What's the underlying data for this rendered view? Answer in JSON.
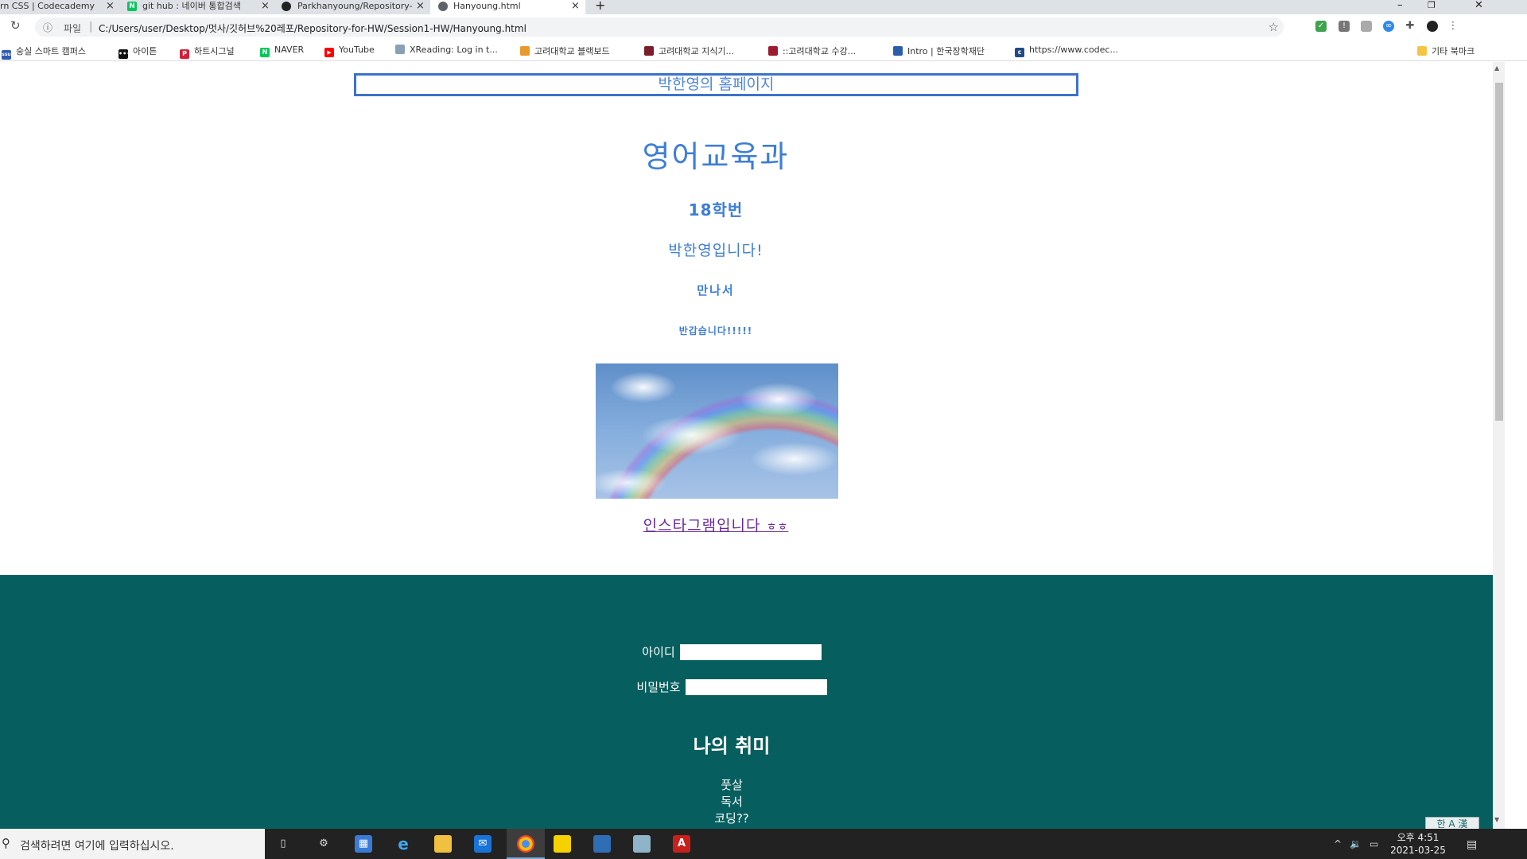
{
  "browser": {
    "tabs": [
      {
        "title": "rn CSS | Codecademy",
        "active": false
      },
      {
        "title": "git hub : 네이버 통합검색",
        "active": false
      },
      {
        "title": "Parkhanyoung/Repository-for-H",
        "active": false
      },
      {
        "title": "Hanyoung.html",
        "active": true
      }
    ],
    "new_tab": "+",
    "close_glyph": "×",
    "window_controls": [
      "–",
      "❐",
      "✕"
    ],
    "address": {
      "scheme_label": "파일",
      "separator": "|",
      "url": "C:/Users/user/Desktop/멋사/깃허브%20레포/Repository-for-HW/Session1-HW/Hanyoung.html"
    },
    "bookmarks": [
      {
        "label": "숭실 스마트 캠퍼스",
        "fav_color": "#2d5bb5",
        "fav": "ssu"
      },
      {
        "label": "아이튼",
        "fav_color": "#111111",
        "fav": "•••"
      },
      {
        "label": "하트시그널",
        "fav_color": "#d6203a",
        "fav": "P"
      },
      {
        "label": "NAVER",
        "fav_color": "#03c75a",
        "fav": "N"
      },
      {
        "label": "YouTube",
        "fav_color": "#ff0000",
        "fav": "▶"
      },
      {
        "label": "XReading: Log in t...",
        "fav_color": "#8aa0b8",
        "fav": ""
      },
      {
        "label": "고려대학교 블랙보드",
        "fav_color": "#e89a2a",
        "fav": ""
      },
      {
        "label": "고려대학교 지식기...",
        "fav_color": "#7a1e2c",
        "fav": ""
      },
      {
        "label": "::고려대학교 수강...",
        "fav_color": "#9b1c2e",
        "fav": ""
      },
      {
        "label": "Intro | 한국장학재단",
        "fav_color": "#2a5ea8",
        "fav": ""
      },
      {
        "label": "https://www.codec...",
        "fav_color": "#1f4a8a",
        "fav": "c"
      }
    ],
    "other_bookmarks": "기타 북마크"
  },
  "page": {
    "title_box": "박한영의 홈페이지",
    "major": "영어교육과",
    "student_id": "18학번",
    "greeting": "박한영입니다!",
    "nice_meet": "만나서",
    "glad": "반갑습니다!!!!!",
    "insta_link_main": "인스타그램입니다 ",
    "insta_link_small": "ㅎㅎ",
    "form": {
      "id_label": "아이디",
      "pw_label": "비밀번호"
    },
    "hobby_title": "나의 취미",
    "hobbies": [
      "풋살",
      "독서",
      "코딩??"
    ]
  },
  "ime": "한 A 漢",
  "taskbar": {
    "search_placeholder": "검색하려면 여기에 입력하십시오.",
    "clock_time": "오후 4:51",
    "clock_date": "2021-03-25"
  }
}
